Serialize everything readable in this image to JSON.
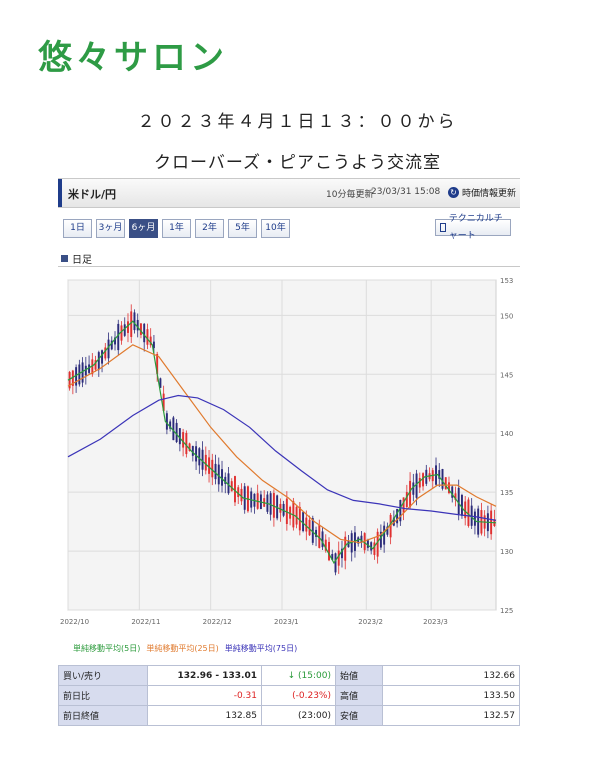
{
  "header": {
    "salon_name": "悠々サロン"
  },
  "event": {
    "datetime": "２０２３年４月１日１３：００から",
    "title": "クローバーズ・ピアこうよう交流室"
  },
  "panel": {
    "pair": "米ドル/円",
    "update_note": "10分毎更新",
    "timestamp": "23/03/31 15:08",
    "refresh_button": "時価情報更新",
    "ranges": [
      "1日",
      "3ヶ月",
      "6ヶ月",
      "1年",
      "2年",
      "5年",
      "10年"
    ],
    "active_range": "6ヶ月",
    "technical_button": "テクニカルチャート",
    "section_title": "日足"
  },
  "chart_data": {
    "type": "candlestick",
    "ylim": [
      125,
      153
    ],
    "y_ticks": [
      "153",
      "150",
      "145",
      "140",
      "135",
      "130",
      "125"
    ],
    "x_ticks": [
      "2022/10",
      "2022/11",
      "2022/12",
      "2023/1",
      "2023/2",
      "2023/3"
    ],
    "series": [
      {
        "name": "単純移動平均(5日)",
        "color": "#2a9a3a",
        "points": [
          [
            0,
            144.5
          ],
          [
            8,
            145.8
          ],
          [
            16,
            148.5
          ],
          [
            20,
            149.5
          ],
          [
            26,
            147.5
          ],
          [
            30,
            141
          ],
          [
            38,
            138.5
          ],
          [
            46,
            136.5
          ],
          [
            54,
            134.5
          ],
          [
            62,
            134
          ],
          [
            70,
            133
          ],
          [
            78,
            131
          ],
          [
            82,
            129
          ],
          [
            86,
            130.6
          ],
          [
            90,
            131
          ],
          [
            94,
            130.2
          ],
          [
            100,
            132.5
          ],
          [
            106,
            135.3
          ],
          [
            110,
            136.3
          ],
          [
            114,
            136.5
          ],
          [
            118,
            135
          ],
          [
            122,
            133.5
          ],
          [
            126,
            132.5
          ],
          [
            132,
            132.4
          ]
        ]
      },
      {
        "name": "単純移動平均(25日)",
        "color": "#e07a2e",
        "points": [
          [
            0,
            144
          ],
          [
            10,
            145.5
          ],
          [
            20,
            147.5
          ],
          [
            28,
            146.5
          ],
          [
            36,
            143.5
          ],
          [
            44,
            140.5
          ],
          [
            52,
            138
          ],
          [
            60,
            136
          ],
          [
            68,
            134.5
          ],
          [
            76,
            132.5
          ],
          [
            84,
            131
          ],
          [
            90,
            130.7
          ],
          [
            96,
            131.3
          ],
          [
            102,
            132.8
          ],
          [
            108,
            134.5
          ],
          [
            114,
            135.6
          ],
          [
            120,
            135.6
          ],
          [
            126,
            134.6
          ],
          [
            132,
            133.8
          ]
        ]
      },
      {
        "name": "単純移動平均(75日)",
        "color": "#3b34b8",
        "points": [
          [
            0,
            138
          ],
          [
            10,
            139.5
          ],
          [
            20,
            141.5
          ],
          [
            28,
            142.8
          ],
          [
            34,
            143.2
          ],
          [
            40,
            143
          ],
          [
            48,
            142
          ],
          [
            56,
            140.5
          ],
          [
            64,
            138.5
          ],
          [
            72,
            136.8
          ],
          [
            80,
            135.2
          ],
          [
            88,
            134.3
          ],
          [
            96,
            134
          ],
          [
            104,
            133.6
          ],
          [
            112,
            133.4
          ],
          [
            120,
            133.1
          ],
          [
            126,
            132.9
          ],
          [
            132,
            132.6
          ]
        ]
      }
    ]
  },
  "quote": {
    "rows": [
      {
        "label": "買い/売り",
        "value": "132.96 - 133.01",
        "change": "↓ (15:00)",
        "label2": "始値",
        "value2": "132.66"
      },
      {
        "label": "前日比",
        "value": "-0.31",
        "change": "(-0.23%)",
        "label2": "高値",
        "value2": "133.50"
      },
      {
        "label": "前日終値",
        "value": "132.85",
        "change": "(23:00)",
        "label2": "安値",
        "value2": "132.57"
      }
    ]
  }
}
